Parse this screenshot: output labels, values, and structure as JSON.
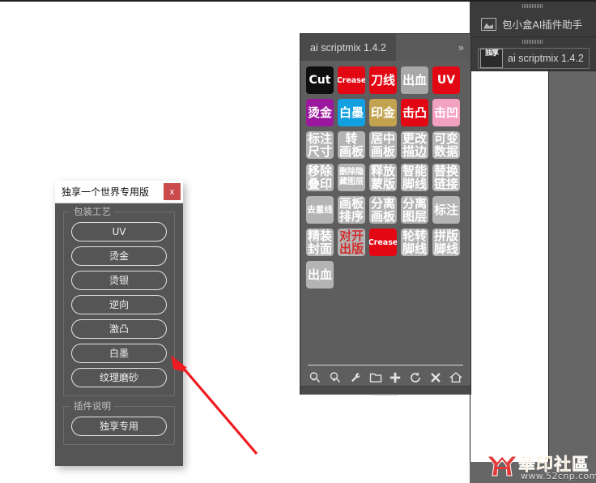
{
  "app": {
    "top_rule": "",
    "dock_tabs": [
      {
        "label": "包小盒AI插件助手",
        "icon": "folder-icon"
      },
      {
        "label": "ai scriptmix 1.4.2",
        "icon": "duxiang-badge-icon",
        "badge_text": "独享"
      }
    ]
  },
  "scriptmix": {
    "tab_label": "ai scriptmix 1.4.2",
    "expand_label": "»",
    "buttons": [
      {
        "label": "Cut",
        "lines": [
          "Cut"
        ],
        "bg": "#0f0f0f",
        "fg": "#ffffff",
        "style": "lat"
      },
      {
        "label": "Crease",
        "lines": [
          "Crease"
        ],
        "bg": "#e30613",
        "fg": "#ffffff",
        "style": "lat-sm"
      },
      {
        "label": "刀线",
        "lines": [
          "刀线"
        ],
        "bg": "#e30613",
        "fg": "#ffffff",
        "style": "cjk2"
      },
      {
        "label": "出血",
        "lines": [
          "出血"
        ],
        "bg": "#a8a8a8",
        "fg": "#ffffff",
        "style": "cjk2"
      },
      {
        "label": "UV",
        "lines": [
          "UV"
        ],
        "bg": "#e30613",
        "fg": "#ffffff",
        "style": "lat"
      },
      {
        "label": "烫金",
        "lines": [
          "烫金"
        ],
        "bg": "#9b179e",
        "fg": "#ffffff",
        "style": "cjk2"
      },
      {
        "label": "白墨",
        "lines": [
          "白墨"
        ],
        "bg": "#13a0e0",
        "fg": "#ffffff",
        "style": "cjk2"
      },
      {
        "label": "印金",
        "lines": [
          "印金"
        ],
        "bg": "#c5a košt",
        "fg": "#ffffff",
        "style": "cjk2"
      },
      {
        "label": "击凸",
        "lines": [
          "击凸"
        ],
        "bg": "#e30613",
        "fg": "#ffffff",
        "style": "cjk2"
      },
      {
        "label": "击凹",
        "lines": [
          "击凹"
        ],
        "bg": "#f2a2c0",
        "fg": "#ffffff",
        "style": "cjk2"
      },
      {
        "label": "标注尺寸",
        "lines": [
          "标注",
          "尺寸"
        ],
        "bg": "#b4b4b4",
        "fg": "#ffffff",
        "style": "cjk2"
      },
      {
        "label": "转画板",
        "lines": [
          "转",
          "画板"
        ],
        "bg": "#b4b4b4",
        "fg": "#ffffff",
        "style": "cjk2"
      },
      {
        "label": "居中画板",
        "lines": [
          "居中",
          "画板"
        ],
        "bg": "#b4b4b4",
        "fg": "#ffffff",
        "style": "cjk2"
      },
      {
        "label": "更改描边",
        "lines": [
          "更改",
          "描边"
        ],
        "bg": "#b4b4b4",
        "fg": "#ffffff",
        "style": "cjk2"
      },
      {
        "label": "可变数据",
        "lines": [
          "可变",
          "数据"
        ],
        "bg": "#b4b4b4",
        "fg": "#ffffff",
        "style": "cjk2"
      },
      {
        "label": "移除叠印",
        "lines": [
          "移除",
          "叠印"
        ],
        "bg": "#b4b4b4",
        "fg": "#ffffff",
        "style": "cjk2"
      },
      {
        "label": "删除隐藏图层",
        "lines": [
          "删除隐",
          "藏图层"
        ],
        "bg": "#b4b4b4",
        "fg": "#ffffff",
        "style": "cjk3"
      },
      {
        "label": "释放蒙版",
        "lines": [
          "释放",
          "蒙版"
        ],
        "bg": "#b4b4b4",
        "fg": "#ffffff",
        "style": "cjk2"
      },
      {
        "label": "智能脚线",
        "lines": [
          "智能",
          "脚线"
        ],
        "bg": "#b4b4b4",
        "fg": "#ffffff",
        "style": "cjk2"
      },
      {
        "label": "替换链接",
        "lines": [
          "替换",
          "链接"
        ],
        "bg": "#b4b4b4",
        "fg": "#ffffff",
        "style": "cjk2"
      },
      {
        "label": "去重线",
        "lines": [
          "去重线"
        ],
        "bg": "#b4b4b4",
        "fg": "#ffffff",
        "style": "cjk-small"
      },
      {
        "label": "画板排序",
        "lines": [
          "画板",
          "排序"
        ],
        "bg": "#b4b4b4",
        "fg": "#ffffff",
        "style": "cjk2"
      },
      {
        "label": "分离画板",
        "lines": [
          "分离",
          "画板"
        ],
        "bg": "#b4b4b4",
        "fg": "#ffffff",
        "style": "cjk2"
      },
      {
        "label": "分离图层",
        "lines": [
          "分离",
          "图层"
        ],
        "bg": "#b4b4b4",
        "fg": "#ffffff",
        "style": "cjk2"
      },
      {
        "label": "标注",
        "lines": [
          "标注"
        ],
        "bg": "#b4b4b4",
        "fg": "#ffffff",
        "style": "cjk2"
      },
      {
        "label": "精装封面",
        "lines": [
          "精装",
          "封面"
        ],
        "bg": "#b4b4b4",
        "fg": "#ffffff",
        "style": "cjk2"
      },
      {
        "label": "对开出版",
        "lines": [
          "对开",
          "出版"
        ],
        "bg": "#b4b4b4",
        "fg": "#d03030",
        "style": "cjk2"
      },
      {
        "label": "Crease",
        "lines": [
          "Crease"
        ],
        "bg": "#e30613",
        "fg": "#ffffff",
        "style": "lat-sm"
      },
      {
        "label": "轮转脚线",
        "lines": [
          "轮转",
          "脚线"
        ],
        "bg": "#b4b4b4",
        "fg": "#ffffff",
        "style": "cjk2"
      },
      {
        "label": "拼版脚线",
        "lines": [
          "拼版",
          "脚线"
        ],
        "bg": "#b4b4b4",
        "fg": "#ffffff",
        "style": "cjk2"
      },
      {
        "label": "出血",
        "lines": [
          "出血"
        ],
        "bg": "#b4b4b4",
        "fg": "#ffffff",
        "style": "cjk2"
      }
    ],
    "footer_icons": [
      {
        "name": "zoom-out-icon",
        "glyph": "⌕"
      },
      {
        "name": "zoom-in-icon",
        "glyph": "⌕"
      },
      {
        "name": "wrench-icon",
        "glyph": "⚒"
      },
      {
        "name": "folder-icon",
        "glyph": "▱"
      },
      {
        "name": "plus-icon",
        "glyph": "✚"
      },
      {
        "name": "refresh-icon",
        "glyph": "↻"
      },
      {
        "name": "close-icon",
        "glyph": "✖"
      },
      {
        "name": "home-icon",
        "glyph": "⌂"
      }
    ]
  },
  "dialog": {
    "title": "独享一个世界专用版",
    "close_label": "x",
    "groups": [
      {
        "legend": "包装工艺",
        "buttons": [
          "UV",
          "烫金",
          "烫银",
          "逆向",
          "激凸",
          "白墨",
          "纹理磨砂"
        ]
      },
      {
        "legend": "插件说明",
        "buttons": [
          "独享专用"
        ]
      }
    ]
  },
  "annotation": {
    "arrow_color": "#ee1c20"
  },
  "watermark": {
    "text": "華印社區",
    "url": "www.52cnp.com",
    "color": "#e8a33d"
  }
}
